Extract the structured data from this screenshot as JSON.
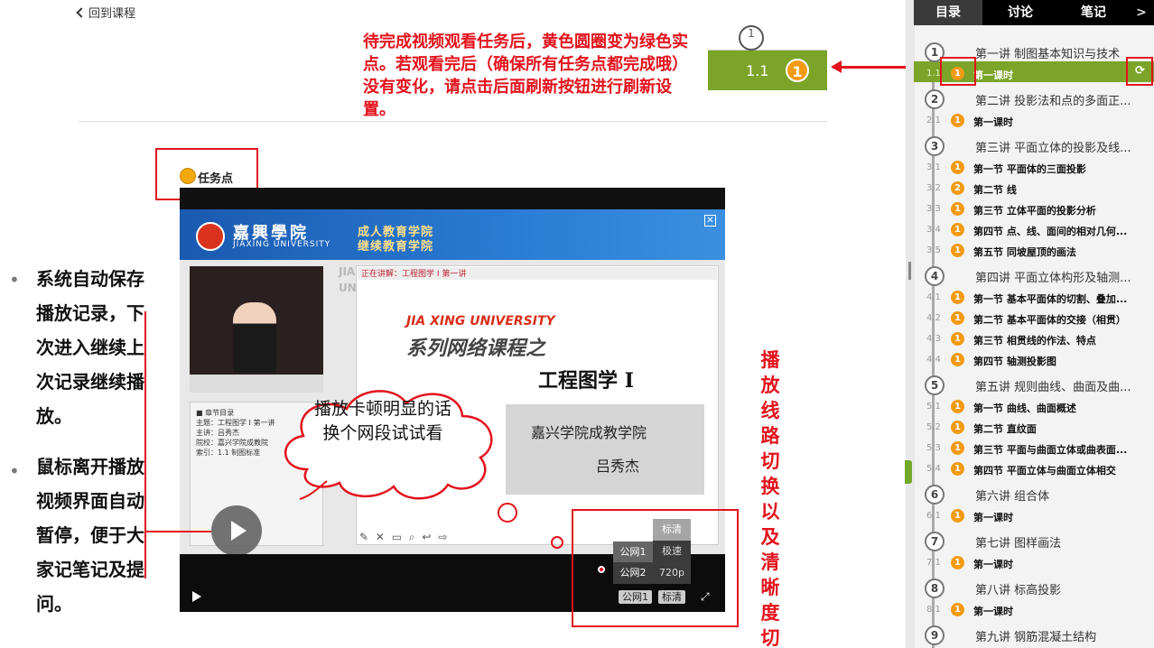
{
  "page": {
    "back_link": "回到课程",
    "note_top": "待完成视频观看任务后，黄色圆圈变为绿色实点。若观看完后（确保所有任务点都完成哦）没有变化，请点击后面刷新按钮进行刷新设置。",
    "strip_circle": "1",
    "strip_num": "1.1",
    "strip_dot": "1",
    "task_label": "任务点",
    "cloud_text": "播放卡顿明显的话换个网段试试看",
    "right_note": "播放线路切换以及清晰度切换。",
    "bullets": [
      {
        "text": "系统自动保存播放记录，下次进入继续上次记录继续播放。"
      },
      {
        "text": "鼠标离开播放视频界面自动暂停，便于大家记笔记及提问。"
      }
    ]
  },
  "player": {
    "uni_name": "嘉興學院",
    "uni_en": "JIAXING UNIVERSITY",
    "school1": "成人教育学院",
    "school2": "继续教育学院",
    "vertical": "JIAXING UNI",
    "slide_header": "正在讲解：工程图学 I 第一讲",
    "slide_en": "JIA XING UNIVERSITY",
    "slide_series": "系列网络课程之",
    "slide_title": "工程图学 I",
    "slide_school": "嘉兴学院成教学院",
    "slide_teacher": "吕秀杰",
    "chapter_panel": "■ 章节目录\n主题：工程图学 I 第一讲\n主讲：吕秀杰\n院校：嘉兴学院成教院\n索引：1.1 制图标准",
    "line_btn": "公网1",
    "quality_btn": "标清",
    "quality_options": [
      "标清",
      "极速",
      "720p"
    ],
    "line_options": [
      "公网1",
      "公网2"
    ],
    "fullscreen": "⤢"
  },
  "sidebar": {
    "tabs": [
      "目录",
      "讨论",
      "笔记"
    ],
    "next": ">",
    "items": [
      {
        "type": "ch",
        "num": "1",
        "title": "第一讲 制图基本知识与技术"
      },
      {
        "type": "sec",
        "num": "1.1",
        "dot": "1",
        "title": "第一课时",
        "active": true
      },
      {
        "type": "ch",
        "num": "2",
        "title": "第二讲 投影法和点的多面正..."
      },
      {
        "type": "sec",
        "num": "2.1",
        "dot": "1",
        "title": "第一课时"
      },
      {
        "type": "ch",
        "num": "3",
        "title": "第三讲 平面立体的投影及线..."
      },
      {
        "type": "sec",
        "num": "3.1",
        "dot": "1",
        "title": "第一节 平面体的三面投影"
      },
      {
        "type": "sec",
        "num": "3.2",
        "dot": "2",
        "title": "第二节 线"
      },
      {
        "type": "sec",
        "num": "3.3",
        "dot": "1",
        "title": "第三节 立体平面的投影分析"
      },
      {
        "type": "sec",
        "num": "3.4",
        "dot": "1",
        "title": "第四节 点、线、面间的相对几何..."
      },
      {
        "type": "sec",
        "num": "3.5",
        "dot": "1",
        "title": "第五节 同坡屋顶的画法"
      },
      {
        "type": "ch",
        "num": "4",
        "title": "第四讲 平面立体构形及轴测..."
      },
      {
        "type": "sec",
        "num": "4.1",
        "dot": "1",
        "title": "第一节 基本平面体的切割、叠加..."
      },
      {
        "type": "sec",
        "num": "4.2",
        "dot": "1",
        "title": "第二节 基本平面体的交接（相贯）"
      },
      {
        "type": "sec",
        "num": "4.3",
        "dot": "1",
        "title": "第三节 相贯线的作法、特点"
      },
      {
        "type": "sec",
        "num": "4.4",
        "dot": "1",
        "title": "第四节 轴测投影图"
      },
      {
        "type": "ch",
        "num": "5",
        "title": "第五讲 规则曲线、曲面及曲..."
      },
      {
        "type": "sec",
        "num": "5.1",
        "dot": "1",
        "title": "第一节 曲线、曲面概述"
      },
      {
        "type": "sec",
        "num": "5.2",
        "dot": "1",
        "title": "第二节 直纹面"
      },
      {
        "type": "sec",
        "num": "5.3",
        "dot": "1",
        "title": "第三节 平面与曲面立体或曲表面..."
      },
      {
        "type": "sec",
        "num": "5.4",
        "dot": "1",
        "title": "第四节 平面立体与曲面立体相交"
      },
      {
        "type": "ch",
        "num": "6",
        "title": "第六讲 组合体"
      },
      {
        "type": "sec",
        "num": "6.1",
        "dot": "1",
        "title": "第一课时"
      },
      {
        "type": "ch",
        "num": "7",
        "title": "第七讲 图样画法"
      },
      {
        "type": "sec",
        "num": "7.1",
        "dot": "1",
        "title": "第一课时"
      },
      {
        "type": "ch",
        "num": "8",
        "title": "第八讲 标高投影"
      },
      {
        "type": "sec",
        "num": "8.1",
        "dot": "1",
        "title": "第一课时"
      },
      {
        "type": "ch",
        "num": "9",
        "title": "第九讲 钢筋混凝土结构"
      }
    ]
  },
  "colors": {
    "accent_green": "#7ba428",
    "annotation_red": "#e3121c",
    "task_orange": "#f39a12"
  }
}
